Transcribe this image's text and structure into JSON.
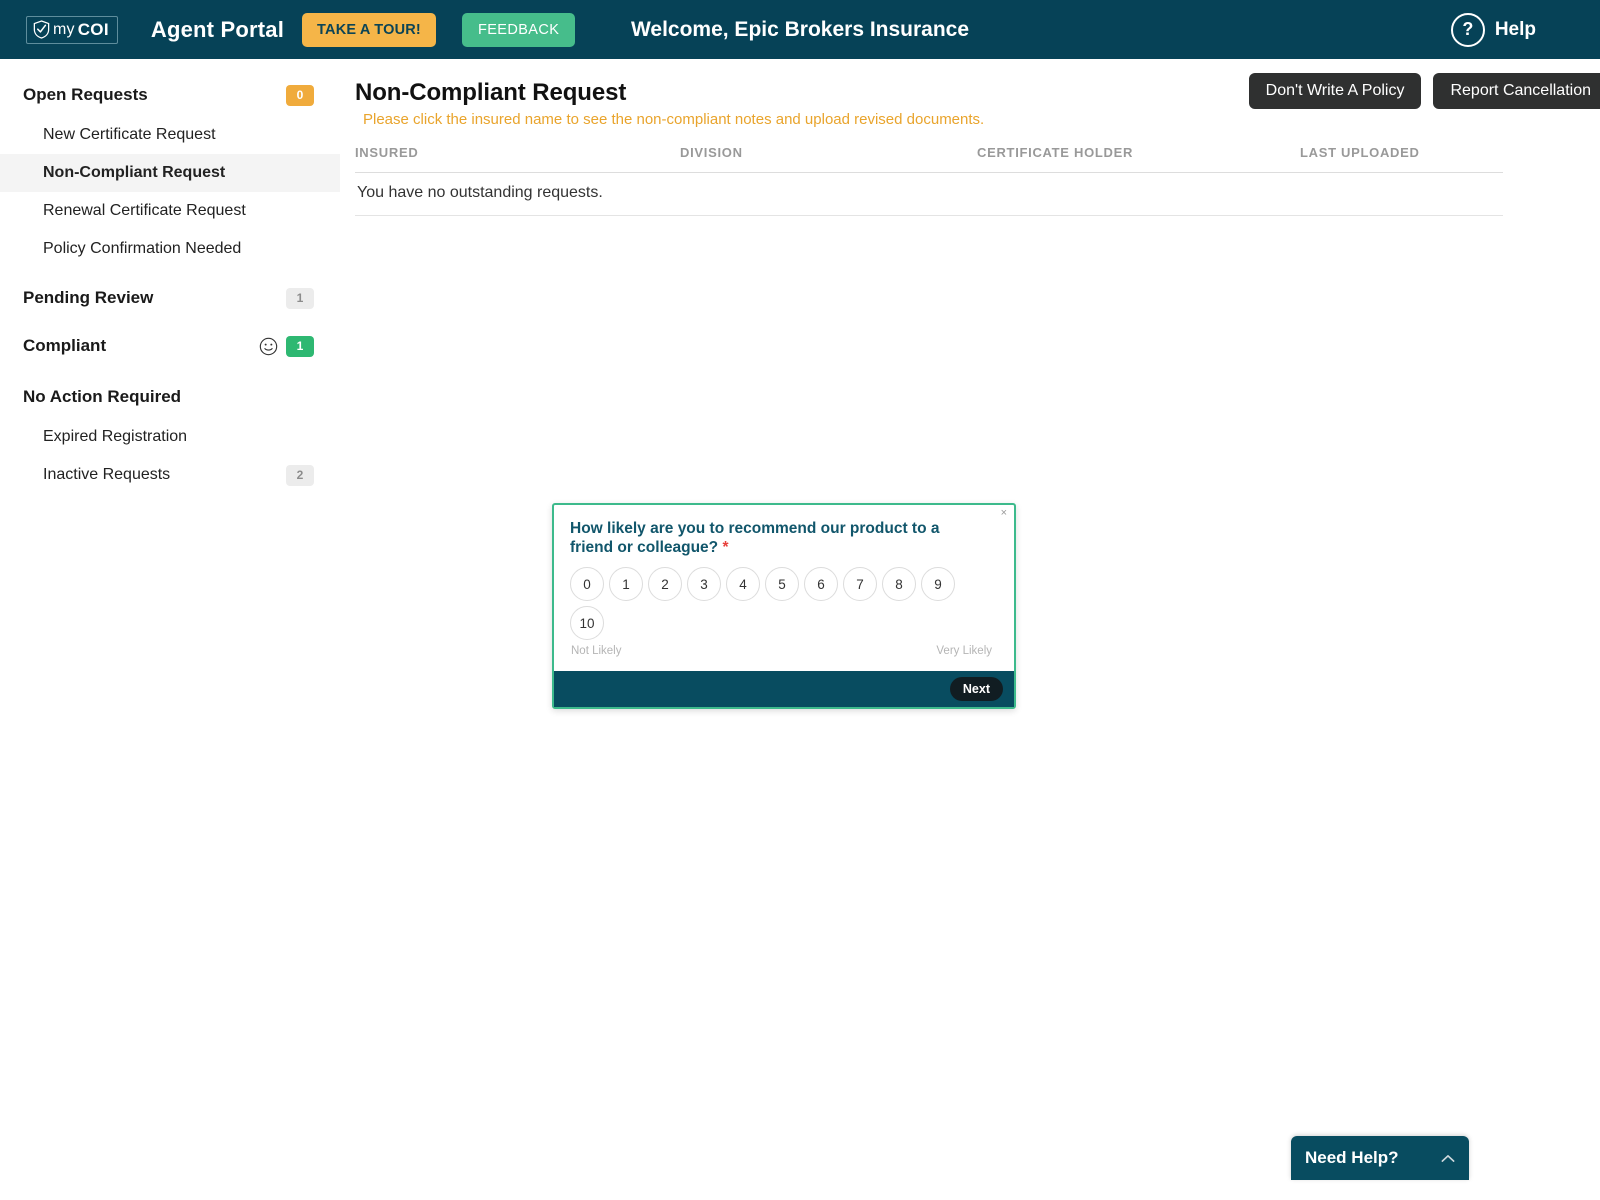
{
  "topbar": {
    "logo": {
      "icon": "shield-check-icon",
      "text_light": "my",
      "text_bold": "COI"
    },
    "portal_title": "Agent Portal",
    "tour_button": "TAKE A TOUR!",
    "feedback_button": "FEEDBACK",
    "welcome": "Welcome, Epic Brokers Insurance",
    "help_icon": "question-mark-icon",
    "help_label": "Help",
    "bg_color": "#064257",
    "tour_color": "#f5b548",
    "feedback_color": "#46bd8b"
  },
  "sidebar": {
    "groups": [
      {
        "label": "Open Requests",
        "badge": "0",
        "badge_style": "amber",
        "items": [
          {
            "label": "New Certificate Request",
            "badge": "",
            "active": false
          },
          {
            "label": "Non-Compliant Request",
            "badge": "",
            "active": true
          },
          {
            "label": "Renewal Certificate Request",
            "badge": "",
            "active": false
          },
          {
            "label": "Policy Confirmation Needed",
            "badge": "",
            "active": false
          }
        ]
      },
      {
        "label": "Pending Review",
        "badge": "1",
        "badge_style": "grey",
        "items": []
      },
      {
        "label": "Compliant",
        "badge": "1",
        "badge_style": "green",
        "icon": "smiley-face-icon",
        "items": []
      },
      {
        "label": "No Action Required",
        "badge": "",
        "badge_style": "",
        "items": [
          {
            "label": "Expired Registration",
            "badge": "",
            "active": false
          },
          {
            "label": "Inactive Requests",
            "badge": "2",
            "active": false
          }
        ]
      }
    ]
  },
  "main": {
    "page_title": "Non-Compliant Request",
    "note": "Please click the insured name to see the non-compliant notes and upload revised documents.",
    "note_color": "#e9a42c",
    "actions": [
      {
        "label": "Don't Write A Policy"
      },
      {
        "label": "Report Cancellation"
      }
    ],
    "table": {
      "headers": [
        "INSURED",
        "DIVISION",
        "CERTIFICATE HOLDER",
        "LAST UPLOADED"
      ],
      "empty_message": "You have no outstanding requests.",
      "rows": []
    }
  },
  "survey": {
    "close_label": "×",
    "question": "How likely are you to recommend our product to a friend or colleague?",
    "required_marker": "*",
    "options": [
      "0",
      "1",
      "2",
      "3",
      "4",
      "5",
      "6",
      "7",
      "8",
      "9",
      "10"
    ],
    "low_label": "Not Likely",
    "high_label": "Very Likely",
    "next_label": "Next",
    "border_color": "#3dba8c",
    "footer_color": "#084c60"
  },
  "need_help": {
    "label": "Need Help?",
    "icon": "chevron-up-icon",
    "bg_color": "#084c60"
  }
}
